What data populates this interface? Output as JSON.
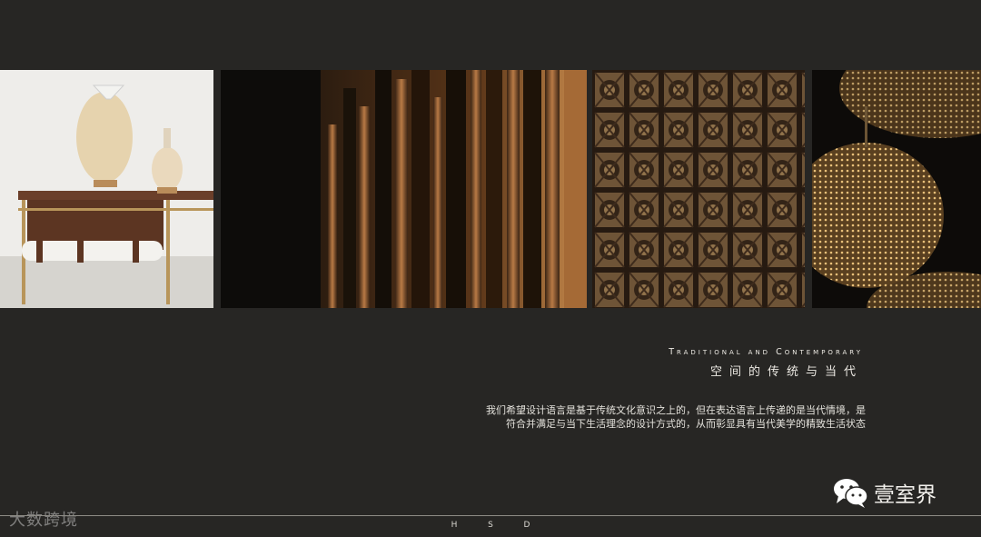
{
  "heading": {
    "english": "Traditional and Contemporary",
    "chinese": "空间的传统与当代"
  },
  "description": {
    "line1": "我们希望设计语言是基于传统文化意识之上的，但在表达语言上传递的是当代情境，是",
    "line2": "符合并满足与当下生活理念的设计方式的，从而彰显具有当代美学的精致生活状态"
  },
  "footer": {
    "letters": [
      "H",
      "S",
      "D"
    ]
  },
  "watermarks": {
    "left": "大数跨境",
    "right": "壹室界"
  },
  "images": [
    {
      "name": "table-with-vases-photo"
    },
    {
      "name": "wooden-slats-light-photo"
    },
    {
      "name": "carved-lattice-wall-photo"
    },
    {
      "name": "perforated-brass-lamp-photo"
    }
  ],
  "colors": {
    "background": "#272624",
    "text": "#ece9e3",
    "rule": "#8e8c86"
  }
}
